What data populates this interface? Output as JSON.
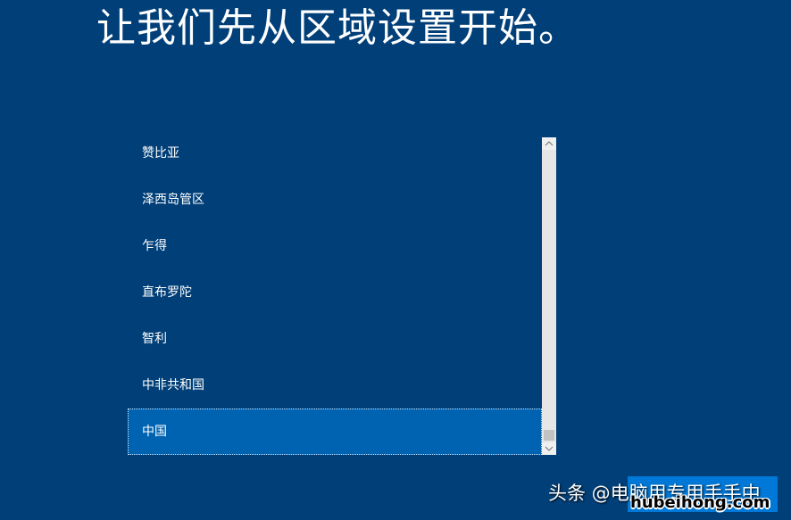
{
  "title": "让我们先从区域设置开始。",
  "region_list": {
    "items": [
      {
        "label": "赞比亚",
        "selected": false
      },
      {
        "label": "泽西岛管区",
        "selected": false
      },
      {
        "label": "乍得",
        "selected": false
      },
      {
        "label": "直布罗陀",
        "selected": false
      },
      {
        "label": "智利",
        "selected": false
      },
      {
        "label": "中非共和国",
        "selected": false
      },
      {
        "label": "中国",
        "selected": true
      }
    ]
  },
  "scrollbar": {
    "up_glyph": "^",
    "down_glyph": "v"
  },
  "watermark": {
    "source": "头条 @电脑用专用手手中",
    "url": "hubeihong.com"
  },
  "colors": {
    "background": "#003f78",
    "selected_item": "#0063b1",
    "button": "#0078d7"
  }
}
